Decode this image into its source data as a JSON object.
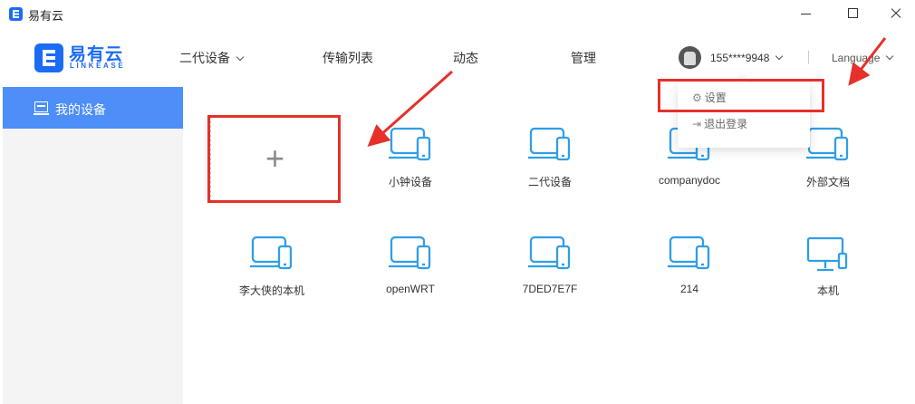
{
  "window": {
    "title": "易有云",
    "icons": [
      "app-icon",
      "minimize-icon",
      "maximize-icon",
      "close-icon"
    ]
  },
  "header": {
    "logo_name": "易有云",
    "logo_sub": "LINKEASE",
    "nav": [
      "二代设备",
      "传输列表",
      "动态",
      "管理"
    ],
    "user_phone": "155****9948",
    "language": "Language"
  },
  "sidebar": {
    "items": [
      {
        "label": "我的设备",
        "icon": "monitor-icon"
      }
    ]
  },
  "dropdown": {
    "items": [
      {
        "label": "设置",
        "icon": "gear-icon"
      },
      {
        "label": "退出登录",
        "icon": "logout-icon"
      }
    ]
  },
  "add_device": {
    "symbol": "+"
  },
  "devices": [
    {
      "label": "小钟设备",
      "icon": "laptop-phone-icon"
    },
    {
      "label": "二代设备",
      "icon": "laptop-phone-icon"
    },
    {
      "label": "companydoc",
      "icon": "laptop-phone-icon"
    },
    {
      "label": "外部文档",
      "icon": "laptop-phone-icon"
    },
    {
      "label": "李大侠的本机",
      "icon": "laptop-phone-icon"
    },
    {
      "label": "openWRT",
      "icon": "laptop-phone-icon"
    },
    {
      "label": "7DED7E7F",
      "icon": "laptop-phone-icon"
    },
    {
      "label": "214",
      "icon": "laptop-phone-icon"
    },
    {
      "label": "本机",
      "icon": "desktop-phone-icon"
    }
  ],
  "colors": {
    "brand": "#1a6cf5",
    "sidebar_active": "#4d8ef8",
    "device_icon": "#2f9ee8",
    "annotation": "#e5312a"
  }
}
